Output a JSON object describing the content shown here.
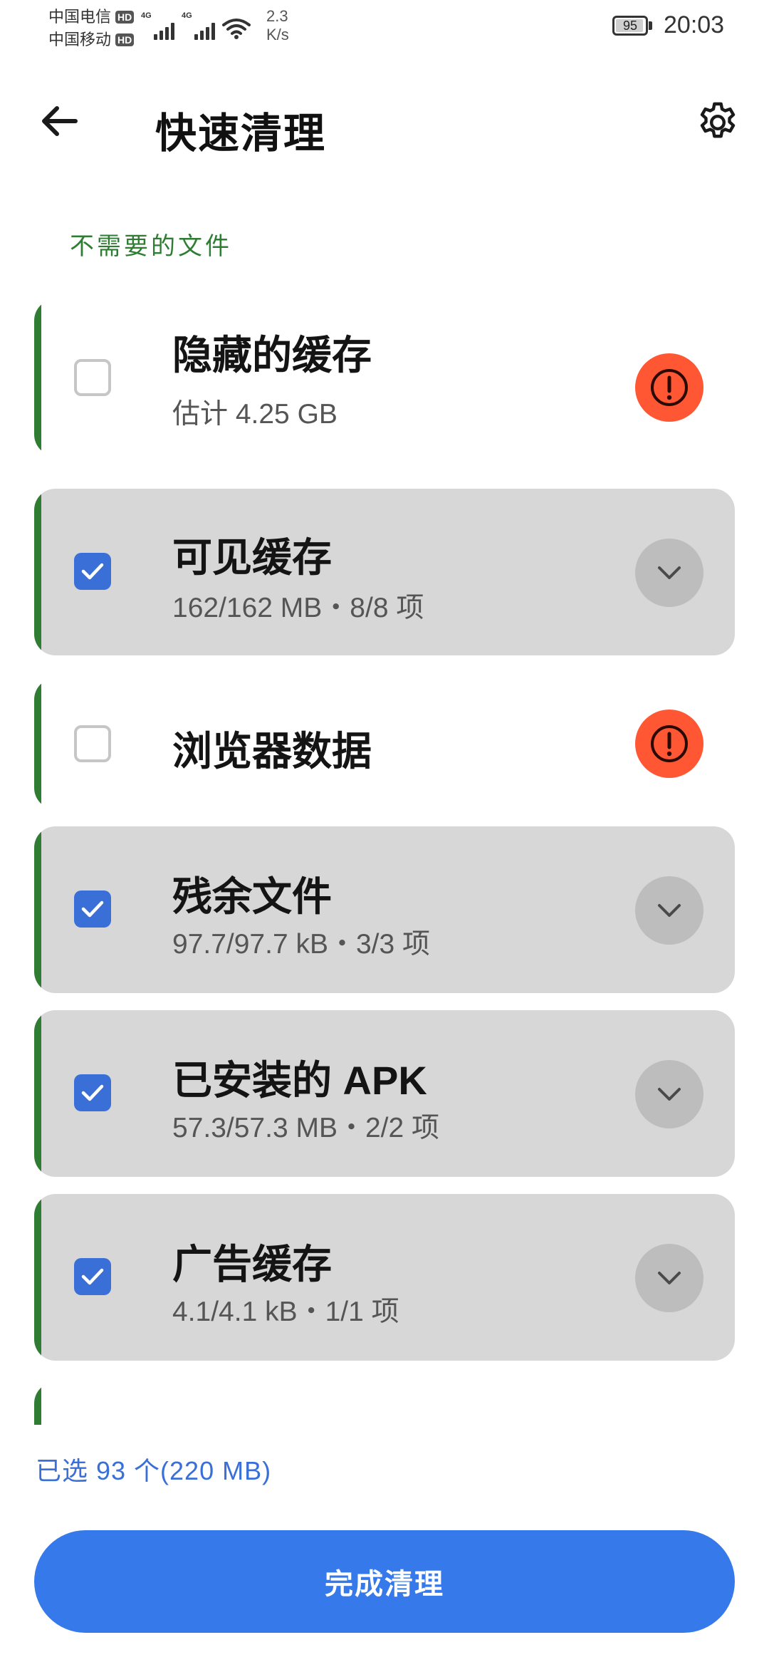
{
  "status_bar": {
    "carrier_1": "中国电信",
    "carrier_2": "中国移动",
    "hd_badge": "HD",
    "network_tag": "4G",
    "net_speed_value": "2.3",
    "net_speed_unit": "K/s",
    "battery_level": "95",
    "battery_fraction": 0.95,
    "time": "20:03"
  },
  "app_bar": {
    "back_icon": "arrow-left-icon",
    "title": "快速清理",
    "settings_icon": "gear-icon"
  },
  "section_label": "不需要的文件",
  "items": [
    {
      "title": "隐藏的缓存",
      "subtitle": "估计 4.25 GB",
      "checked": false,
      "action_icon": "exclamation-circle-icon"
    },
    {
      "title": "可见缓存",
      "subtitle": "162/162 MB・8/8 项",
      "checked": true,
      "action_icon": "chevron-down-icon"
    },
    {
      "title": "浏览器数据",
      "subtitle": "",
      "checked": false,
      "action_icon": "exclamation-circle-icon"
    },
    {
      "title": "残余文件",
      "subtitle": "97.7/97.7 kB・3/3 项",
      "checked": true,
      "action_icon": "chevron-down-icon"
    },
    {
      "title": "已安装的 APK",
      "subtitle": "57.3/57.3 MB・2/2 项",
      "checked": true,
      "action_icon": "chevron-down-icon"
    },
    {
      "title": "广告缓存",
      "subtitle": "4.1/4.1 kB・1/1 项",
      "checked": true,
      "action_icon": "chevron-down-icon"
    }
  ],
  "selection_summary": "已选 93 个(220 MB)",
  "finish_button_label": "完成清理",
  "colors": {
    "accent_green": "#2e7d32",
    "warning_orange": "#ff5733",
    "primary_blue": "#3579ea",
    "checkbox_blue": "#3a6fd8",
    "selected_card_gray": "#d7d7d7"
  }
}
